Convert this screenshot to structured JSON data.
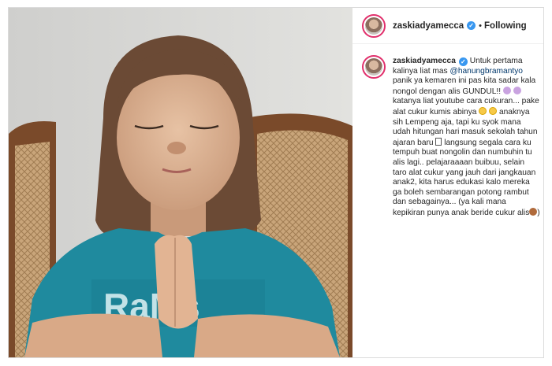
{
  "post": {
    "username": "zaskiadyamecca",
    "verified_icon": "verified-badge-icon",
    "separator": "•",
    "follow_status": "Following",
    "caption": {
      "username": "zaskiadyamecca",
      "part1": " Untuk pertama kalinya liat mas ",
      "mention": "@hanungbramantyo",
      "part2": " panik ya kemaren ini pas kita sadar kala nongol dengan alis GUNDUL!! ",
      "part3": " katanya liat youtube cara cukuran... pake alat cukur kumis abinya ",
      "part4": " anaknya sih Lempeng aja, tapi ku syok mana udah hitungan hari masuk sekolah tahun ajaran baru ",
      "part5": " langsung segala cara ku tempuh buat nongolin dan numbuhin tu alis lagi.. pelajaraaaan buibuu, selain taro alat cukur yang jauh dari jangkauan anak2, kita harus edukasi kalo mereka ga boleh sembarangan potong rambut dan sebagainya... (ya kali mana kepikiran punya anak beride cukur alis",
      "part6": ")"
    }
  },
  "colors": {
    "verified": "#3897f0",
    "border": "#dbdbdb",
    "mention": "#00376b",
    "text": "#262626"
  }
}
